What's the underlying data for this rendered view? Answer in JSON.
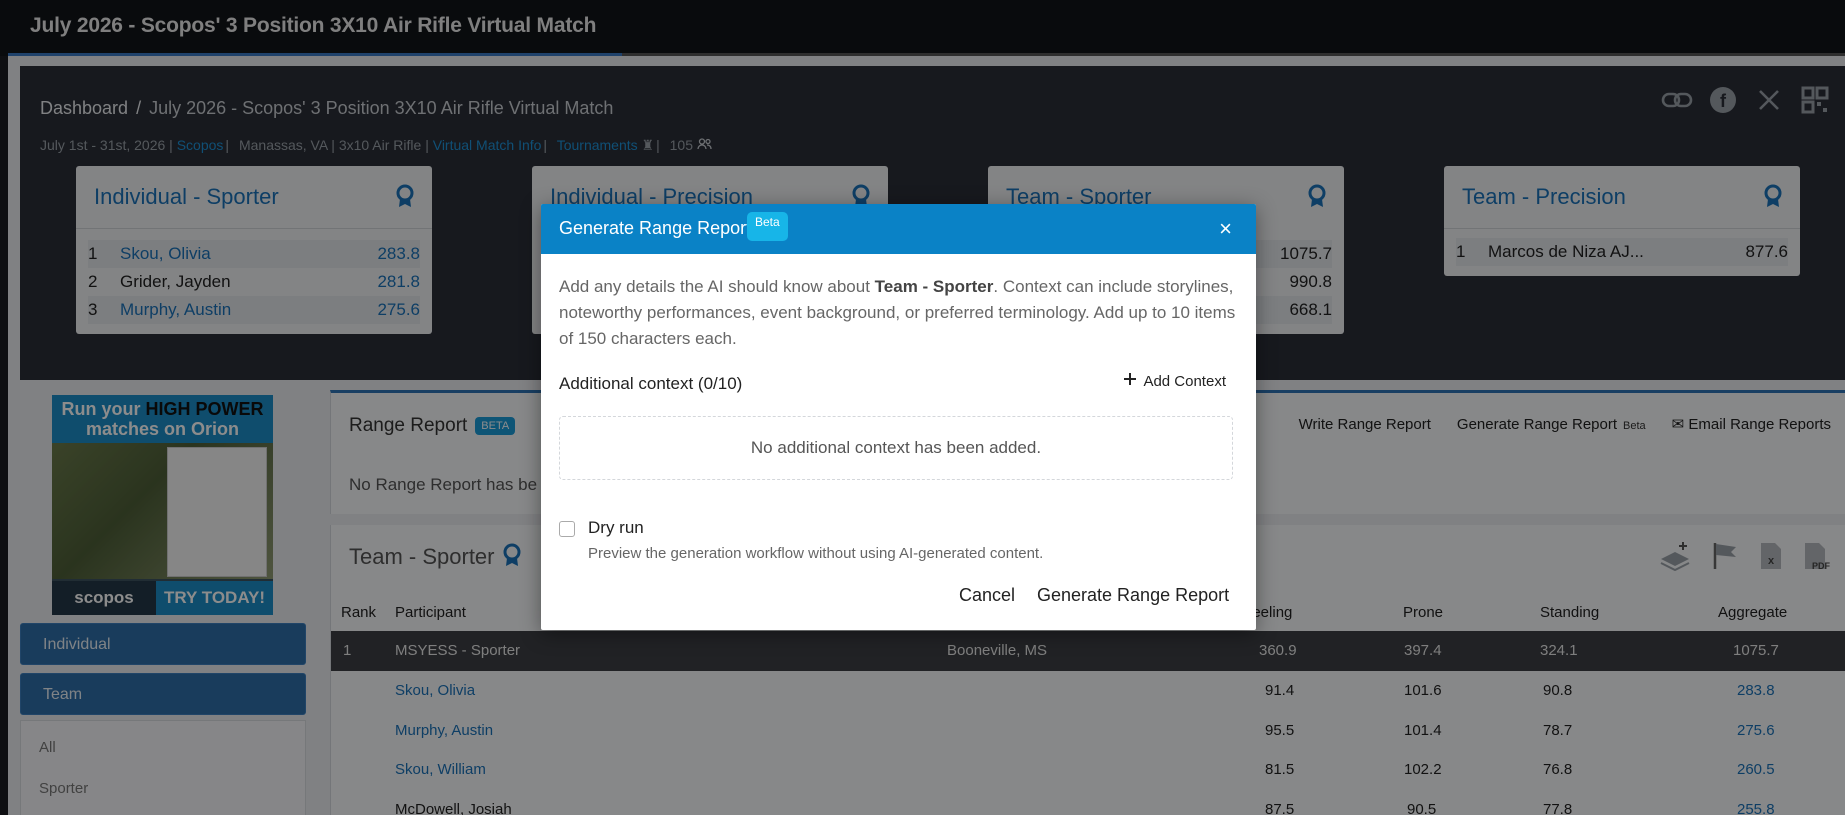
{
  "topbar": {
    "title": "July 2026 - Scopos' 3 Position 3X10 Air Rifle Virtual Match",
    "progress_fraction": 0.34
  },
  "breadcrumb": {
    "home": "Dashboard",
    "separator": "/",
    "current": "July 2026 - Scopos' 3 Position 3X10 Air Rifle Virtual Match"
  },
  "meta": {
    "dates": "July 1st - 31st, 2026 |",
    "org": "Scopos",
    "location": "Manassas, VA |",
    "discipline": "3x10 Air Rifle |",
    "virtual_info": "Virtual Match Info",
    "tournaments": "Tournaments",
    "count": "105"
  },
  "share_icons": [
    "link-icon",
    "facebook-icon",
    "x-icon",
    "qr-code-icon"
  ],
  "cards": [
    {
      "title": "Individual - Sporter",
      "rows": [
        {
          "rank": "1",
          "name": "Skou, Olivia",
          "score": "283.8"
        },
        {
          "rank": "2",
          "name": "Grider, Jayden",
          "score": "281.8"
        },
        {
          "rank": "3",
          "name": "Murphy, Austin",
          "score": "275.6"
        }
      ]
    },
    {
      "title": "Individual - Precision"
    },
    {
      "title": "Team - Sporter",
      "scores": [
        "1075.7",
        "990.8",
        "668.1"
      ]
    },
    {
      "title": "Team - Precision",
      "rows": [
        {
          "rank": "1",
          "name": "Marcos de Niza AJ...",
          "score": "877.6"
        }
      ]
    }
  ],
  "ad": {
    "line1": "Run your ",
    "highlight": "HIGH POWER",
    "line2": "matches on Orion",
    "brand": "scopos",
    "cta": "TRY TODAY!"
  },
  "sidebar": {
    "individual": "Individual",
    "team": "Team",
    "options": [
      "All",
      "Sporter"
    ]
  },
  "range_report": {
    "title": "Range Report",
    "beta": "BETA",
    "message": "No Range Report has be",
    "actions": {
      "write": "Write Range Report",
      "generate": "Generate Range Report",
      "generate_beta": "Beta",
      "email": "Email Range Reports"
    }
  },
  "team_table": {
    "title": "Team - Sporter",
    "headers": {
      "rank": "Rank",
      "participant": "Participant",
      "kneeling": "neeling",
      "prone": "Prone",
      "standing": "Standing",
      "aggregate": "Aggregate"
    },
    "rows": [
      {
        "rank": "1",
        "participant": "MSYESS - Sporter",
        "hometown": "Booneville, MS",
        "kneeling": "360.9",
        "prone": "397.4",
        "standing": "324.1",
        "aggregate": "1075.7",
        "team": true
      },
      {
        "rank": "",
        "participant": "Skou, Olivia",
        "hometown": "",
        "kneeling": "91.4",
        "prone": "101.6",
        "standing": "90.8",
        "aggregate": "283.8",
        "link": true
      },
      {
        "rank": "",
        "participant": "Murphy, Austin",
        "hometown": "",
        "kneeling": "95.5",
        "prone": "101.4",
        "standing": "78.7",
        "aggregate": "275.6",
        "link": true
      },
      {
        "rank": "",
        "participant": "Skou, William",
        "hometown": "",
        "kneeling": "81.5",
        "prone": "102.2",
        "standing": "76.8",
        "aggregate": "260.5",
        "link": true
      },
      {
        "rank": "",
        "participant": "McDowell, Josiah",
        "hometown": "",
        "kneeling": "87.5",
        "prone": "90.5",
        "standing": "77.8",
        "aggregate": "255.8",
        "link": false
      }
    ]
  },
  "modal": {
    "title": "Generate Range Report",
    "beta": "Beta",
    "close": "×",
    "desc_pre": "Add any details the AI should know about ",
    "desc_bold": "Team - Sporter",
    "desc_post": ". Context can include storylines, noteworthy performances, event background, or preferred terminology. Add up to 10 items of 150 characters each.",
    "context_label": "Additional context (0/10)",
    "add_context": "Add Context",
    "empty": "No additional context has been added.",
    "dry_run_label": "Dry run",
    "dry_run_help": "Preview the generation workflow without using AI-generated content.",
    "dry_run_checked": false,
    "cancel": "Cancel",
    "generate": "Generate Range Report"
  },
  "colors": {
    "accent": "#0a82c6",
    "link": "#1a72b8",
    "dark_header": "#2a2f38",
    "topbar": "#111418"
  }
}
